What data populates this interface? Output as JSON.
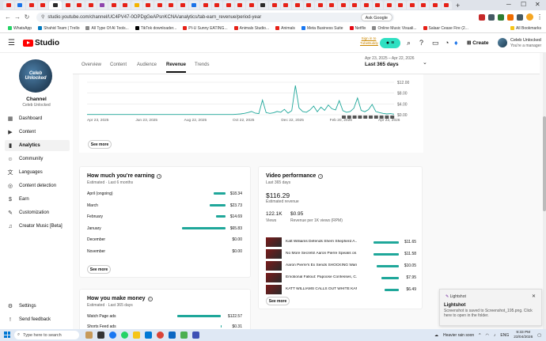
{
  "browser": {
    "url": "studio.youtube.com/channel/UC4PV47-0OPDgGeAPsnKCNA/analytics/tab-earn_revenue/period-year",
    "ask_google": "Ask Google",
    "bookmarks": [
      "WhatsApp",
      "Shahid Team | Trello",
      "All Type Of AI Tools...",
      "TikTok downloader...",
      "PI-U Sunny EATING...",
      "Animals Studio...",
      "Animals",
      "Meta Business Suite",
      "Netflix",
      "Online Music Visuali...",
      "Salaar Cease Fire (2..."
    ],
    "all_bookmarks": "All Bookmarks"
  },
  "header": {
    "studio": "Studio",
    "tubebuddy": "Sign in to TubeBuddy",
    "create": "Create",
    "account_name": "Celeb Unlocked",
    "account_sub": "You're a manager"
  },
  "sidebar": {
    "avatar_text": "Celeb Unlocked",
    "channel_label": "Channel",
    "channel_name": "Celeb Unlocked",
    "items": [
      {
        "label": "Dashboard",
        "icon": "dashboard-icon"
      },
      {
        "label": "Content",
        "icon": "content-icon"
      },
      {
        "label": "Analytics",
        "icon": "analytics-icon"
      },
      {
        "label": "Community",
        "icon": "community-icon"
      },
      {
        "label": "Languages",
        "icon": "languages-icon"
      },
      {
        "label": "Content detection",
        "icon": "content-detection-icon"
      },
      {
        "label": "Earn",
        "icon": "earn-icon"
      },
      {
        "label": "Customization",
        "icon": "customization-icon"
      },
      {
        "label": "Creator Music [Beta]",
        "icon": "music-icon"
      }
    ],
    "settings": "Settings",
    "feedback": "Send feedback"
  },
  "analytics": {
    "tabs": [
      "Overview",
      "Content",
      "Audience",
      "Revenue",
      "Trends"
    ],
    "date_range": "Apr 23, 2025 – Apr 22, 2026",
    "period": "Last 365 days"
  },
  "chart_data": {
    "type": "line",
    "x_ticks": [
      "Apr 23, 2025",
      "Jun 23, 2025",
      "Aug 22, 2025",
      "Oct 22, 2025",
      "Dec 22, 2025",
      "Feb 20, 2026",
      "Apr 22, 2026"
    ],
    "y_ticks": [
      "$12.00",
      "$8.00",
      "$4.00",
      "$0.00"
    ],
    "ylim": [
      0,
      12
    ],
    "series": [
      {
        "values": [
          0.1,
          0.1,
          0.1,
          0.1,
          0.1,
          0.1,
          0.1,
          0.1,
          0.1,
          0.1,
          0.1,
          0.1,
          0.1,
          0.1,
          0.1,
          0.1,
          0.1,
          0.1,
          0.1,
          0.1,
          0.1,
          0.1,
          0.1,
          0.1,
          0.1,
          0.1,
          0.1,
          0.1,
          0.1,
          0.1,
          0.1,
          0.1,
          0.1,
          0.1,
          0.1,
          0.1,
          0.1,
          0.1,
          0.1,
          0.1,
          0.1,
          0.2,
          0.3,
          0.5,
          0.8,
          1.2,
          0.6,
          0.4,
          5.4,
          0.8,
          0.5,
          0.7,
          1.2,
          0.9,
          2.0,
          0.6,
          1.5,
          10.8,
          2.5,
          1.2,
          0.9,
          1.8,
          3.2,
          1.1,
          2.8,
          1.6,
          3.6,
          2.2,
          1.8,
          5.2,
          1.5,
          0.9,
          1.2,
          2.4,
          6.2,
          1.6,
          1.1,
          1.9,
          3.8,
          1.2,
          0.8,
          0.5,
          0.3,
          0.4,
          0.2
        ]
      }
    ]
  },
  "earning": {
    "title": "How much you're earning",
    "sub": "Estimated · Last 6 months",
    "rows": [
      {
        "label": "April (ongoing)",
        "amount": "$18.34",
        "value": 18.34
      },
      {
        "label": "March",
        "amount": "$23.73",
        "value": 23.73
      },
      {
        "label": "February",
        "amount": "$14.69",
        "value": 14.69
      },
      {
        "label": "January",
        "amount": "$65.83",
        "value": 65.83
      },
      {
        "label": "December",
        "amount": "$0.00",
        "value": 0
      },
      {
        "label": "November",
        "amount": "$0.00",
        "value": 0
      }
    ],
    "see_more": "See more"
  },
  "video_perf": {
    "title": "Video performance",
    "sub": "Last 365 days",
    "revenue": "$116.29",
    "revenue_label": "Estimated revenue",
    "views": "122.1K",
    "views_label": "Views",
    "rpm": "$0.95",
    "rpm_label": "Revenue per 1K views (RPM)",
    "rows": [
      {
        "title": "Katt Williams Defends Sherri Shepherd A...",
        "amount": "$11.65",
        "value": 11.65
      },
      {
        "title": "No More Secrets! Aaron Pierre Speaks on...",
        "amount": "$11.58",
        "value": 11.58
      },
      {
        "title": "Aaron Pierre's Ex Sends SHOCKING Warn...",
        "amount": "$10.05",
        "value": 10.05
      },
      {
        "title": "Emotional Fallout: Papoose Confesses, C...",
        "amount": "$7.95",
        "value": 7.95
      },
      {
        "title": "KATT WILLIAMS CALLS OUT WHITE KAR...",
        "amount": "$6.49",
        "value": 6.49
      }
    ],
    "see_more": "See more"
  },
  "make_money": {
    "title": "How you make money",
    "sub": "Estimated · Last 365 days",
    "rows": [
      {
        "label": "Watch Page ads",
        "amount": "$122.57",
        "value": 122.57
      },
      {
        "label": "Shorts Feed ads",
        "amount": "$0.31",
        "value": 0.31
      }
    ]
  },
  "toast": {
    "app": "Lightshot",
    "title": "Lightshot",
    "body": "Screenshot is saved to Screenshot_195.png. Click here to open in the folder."
  },
  "taskbar": {
    "search": "Type here to search",
    "weather": "Heavier rain soon",
    "lang": "ENG",
    "time": "9:33 PM",
    "date": "23/04/2026"
  }
}
